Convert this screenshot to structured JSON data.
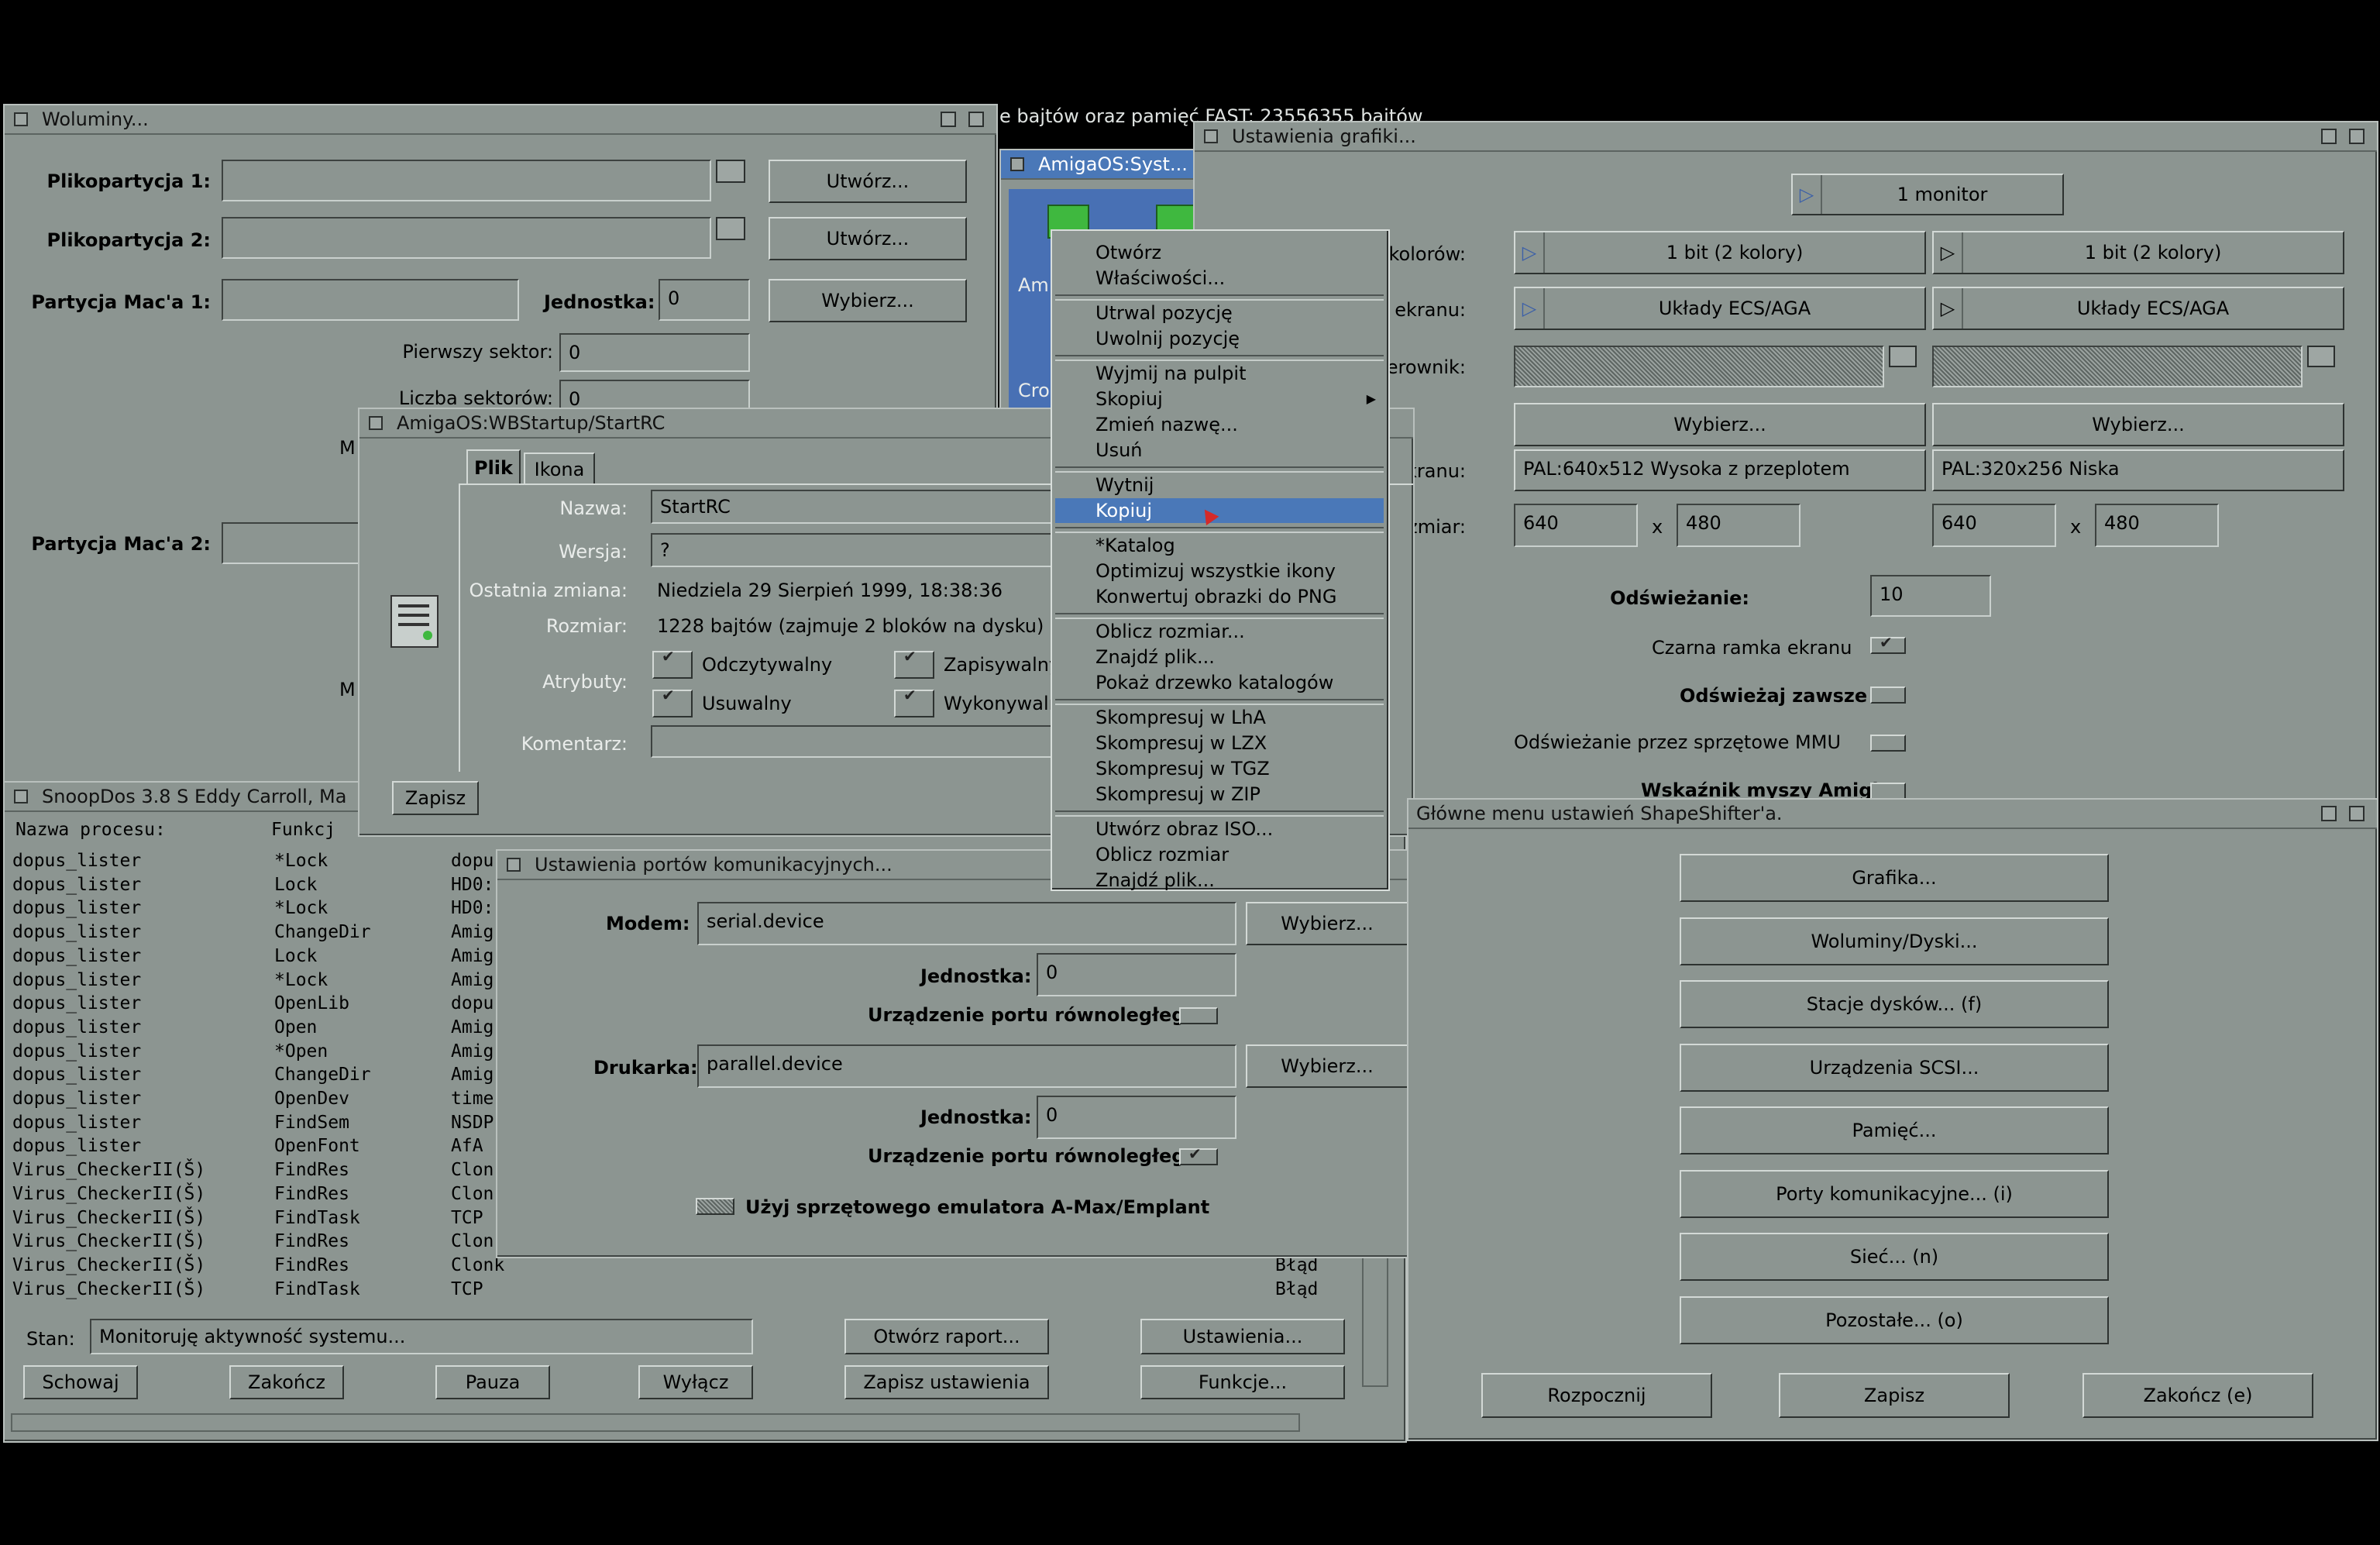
{
  "background_banner": "e bajtów oraz pamięć FAST: 23556355 bajtów",
  "volumes_win": {
    "title": "Woluminy...",
    "file_part1_label": "Plikopartycja 1:",
    "file_part2_label": "Plikopartycja 2:",
    "create_btn": "Utwórz...",
    "mac_part1_label": "Partycja Mac'a 1:",
    "unit_label": "Jednostka:",
    "unit_value": "0",
    "choose_btn": "Wybierz...",
    "first_sector_label": "Pierwszy sektor:",
    "first_sector_value": "0",
    "sector_count_label": "Liczba sektorów:",
    "sector_count_value": "0",
    "mac_part2_label": "Partycja Mac'a 2:",
    "m_fragment": "M"
  },
  "amiga_sys_win": {
    "title": "AmigaOS:Syst...",
    "icon_label_1": "Ami",
    "icon_label_2": "Cro"
  },
  "graphics_win": {
    "title": "Ustawienia grafiki...",
    "monitor_cycle": "1 monitor",
    "colors_label": "ść kolorów:",
    "colors_left": "1 bit (2 kolory)",
    "colors_right": "1 bit (2 kolory)",
    "screen_type_label": "Typ ekranu:",
    "screen_type_left": "Układy ECS/AGA",
    "screen_type_right": "Układy ECS/AGA",
    "driver_label": "sterownik:",
    "choose_btn": "Wybierz...",
    "screen_mode_label": "ekranu:",
    "screen_mode_left": "PAL:640x512 Wysoka z przeplotem",
    "screen_mode_right": "PAL:320x256 Niska",
    "size_label": "Rozmiar:",
    "size_x": "x",
    "width_left": "640",
    "height_left": "480",
    "width_right": "640",
    "height_right": "480",
    "refresh_label": "Odświeżanie:",
    "refresh_value": "10",
    "black_frame_label": "Czarna ramka ekranu",
    "refresh_always_label": "Odświeżaj zawsze",
    "mmu_refresh_label": "Odświeżanie przez sprzętowe MMU",
    "mouse_pointer_label": "Wskaźnik myszy Amigi"
  },
  "startrc_win": {
    "title": "AmigaOS:WBStartup/StartRC",
    "tab_file": "Plik",
    "tab_icon": "Ikona",
    "name_label": "Nazwa:",
    "name_value": "StartRC",
    "version_label": "Wersja:",
    "version_value": "?",
    "modified_label": "Ostatnia zmiana:",
    "modified_value": "Niedziela 29 Sierpień 1999, 18:38:36",
    "size_label": "Rozmiar:",
    "size_value": "1228 bajtów (zajmuje 2 bloków na dysku)",
    "attrs_label": "Atrybuty:",
    "attr_read": "Odczytywalny",
    "attr_write": "Zapisywalny",
    "attr_delete": "Usuwalny",
    "attr_exec": "Wykonywalny",
    "comment_label": "Komentarz:",
    "save_btn": "Zapisz"
  },
  "context_menu": {
    "items": [
      "Otwórz",
      "Właściwości...",
      "Utrwal pozycję",
      "Uwolnij pozycję",
      "Wyjmij na pulpit",
      "Skopiuj",
      "Zmień nazwę...",
      "Usuń",
      "Wytnij",
      "Kopiuj",
      "*Katalog",
      "Optimizuj wszystkie ikony",
      "Konwertuj obrazki do PNG",
      "Oblicz rozmiar...",
      "Znajdź plik...",
      "Pokaż drzewko katalogów",
      "Skompresuj w LhA",
      "Skompresuj w LZX",
      "Skompresuj w TGZ",
      "Skompresuj w ZIP",
      "Utwórz obraz ISO...",
      "Oblicz rozmiar",
      "Znajdź plik..."
    ],
    "submenu_arrow": "▶"
  },
  "snoopdos_win": {
    "title": "SnoopDos 3.8 S Eddy Carroll, Ma",
    "col_process": "Nazwa procesu:",
    "col_function": "Funkcj",
    "rows": [
      [
        "dopus_lister",
        "*Lock",
        "dopu",
        ""
      ],
      [
        "dopus_lister",
        "Lock",
        "HD0:",
        ""
      ],
      [
        "dopus_lister",
        "*Lock",
        "HD0:",
        ""
      ],
      [
        "dopus_lister",
        "ChangeDir",
        "Amig",
        ""
      ],
      [
        "dopus_lister",
        "Lock",
        "Amig",
        ""
      ],
      [
        "dopus_lister",
        "*Lock",
        "Amig",
        ""
      ],
      [
        "dopus_lister",
        "OpenLib",
        "dopu",
        ""
      ],
      [
        "dopus_lister",
        "Open",
        "Amig",
        ""
      ],
      [
        "dopus_lister",
        "*Open",
        "Amig",
        ""
      ],
      [
        "dopus_lister",
        "ChangeDir",
        "Amig",
        ""
      ],
      [
        "dopus_lister",
        "OpenDev",
        "time",
        ""
      ],
      [
        "dopus_lister",
        "FindSem",
        "NSDP",
        ""
      ],
      [
        "dopus_lister",
        "OpenFont",
        "AfA",
        ""
      ],
      [
        "Virus_CheckerII(Š)",
        "FindRes",
        "Clon",
        ""
      ],
      [
        "Virus_CheckerII(Š)",
        "FindRes",
        "Clon",
        ""
      ],
      [
        "Virus_CheckerII(Š)",
        "FindTask",
        "TCP",
        ""
      ],
      [
        "Virus_CheckerII(Š)",
        "FindRes",
        "Clon",
        ""
      ],
      [
        "Virus_CheckerII(Š)",
        "FindRes",
        "Clonk",
        "Błąd"
      ],
      [
        "Virus_CheckerII(Š)",
        "FindTask",
        "TCP",
        "Błąd"
      ]
    ],
    "status_label": "Stan:",
    "status_value": "Monitoruję aktywność systemu...",
    "open_report_btn": "Otwórz raport...",
    "settings_btn": "Ustawienia...",
    "hide_btn": "Schowaj",
    "quit_btn": "Zakończ",
    "pause_btn": "Pauza",
    "disable_btn": "Wyłącz",
    "save_settings_btn": "Zapisz ustawienia",
    "functions_btn": "Funkcje..."
  },
  "ports_win": {
    "title": "Ustawienia portów komunikacyjnych...",
    "modem_label": "Modem:",
    "modem_value": "serial.device",
    "choose_btn": "Wybierz...",
    "unit_label": "Jednostka:",
    "unit_value_modem": "0",
    "parallel_label": "Urządzenie portu równoległego",
    "printer_label": "Drukarka:",
    "printer_value": "parallel.device",
    "unit_value_printer": "0",
    "amax_label": "Użyj sprzętowego emulatora A-Max/Emplant"
  },
  "shapeshifter_win": {
    "title": "Główne menu ustawień ShapeShifter'a.",
    "buttons": [
      "Grafika...",
      "Woluminy/Dyski...",
      "Stacje dysków... (f)",
      "Urządzenia SCSI...",
      "Pamięć...",
      "Porty komunikacyjne... (i)",
      "Sieć... (n)",
      "Pozostałe... (o)"
    ],
    "start_btn": "Rozpocznij",
    "save_btn": "Zapisz",
    "quit_btn": "Zakończ (e)"
  },
  "colors": {
    "window_bg": "#8c9591",
    "selection": "#4a78b8",
    "desktop": "#000000"
  }
}
